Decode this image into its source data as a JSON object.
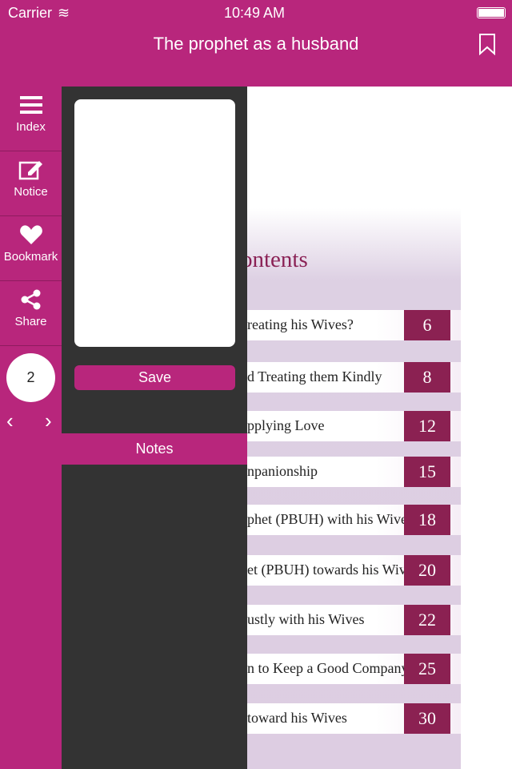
{
  "status": {
    "carrier": "Carrier",
    "time": "10:49 AM"
  },
  "header": {
    "title": "The prophet as a husband"
  },
  "sidebar": {
    "items": [
      {
        "label": "Index"
      },
      {
        "label": "Notice"
      },
      {
        "label": "Bookmark"
      },
      {
        "label": "Share"
      }
    ],
    "page": "2",
    "prev": "‹",
    "next": "›"
  },
  "panel": {
    "save": "Save",
    "notes": "Notes",
    "note_value": ""
  },
  "doc": {
    "title": "ontents",
    "rows": [
      {
        "text": "reating his Wives?",
        "page": "6"
      },
      {
        "text": "d Treating them Kindly",
        "page": "8"
      },
      {
        "text": "pplying Love",
        "page": "12"
      },
      {
        "text": "npanionship",
        "page": "15"
      },
      {
        "text": "phet (PBUH) with his Wives",
        "page": "18"
      },
      {
        "text": "et (PBUH) towards his Wives",
        "page": "20"
      },
      {
        "text": "ustly with his Wives",
        "page": "22"
      },
      {
        "text": "n to Keep a Good Company",
        "page": "25"
      },
      {
        "text": "toward his Wives",
        "page": "30"
      }
    ]
  },
  "colors": {
    "brand": "#b8267c",
    "page_box": "#8b2152",
    "panel": "#333333"
  }
}
